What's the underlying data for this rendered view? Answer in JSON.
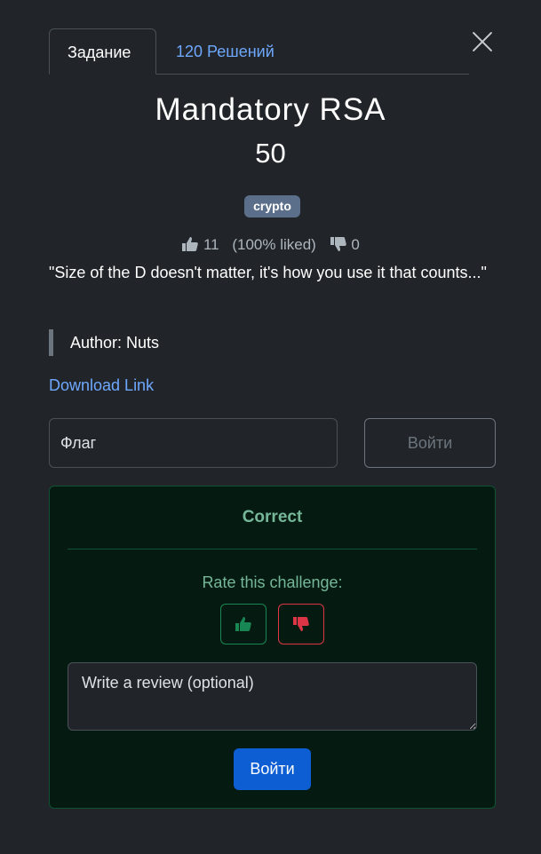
{
  "tabs": [
    {
      "label": "Задание",
      "active": true
    },
    {
      "label": "120 Решений",
      "active": false
    }
  ],
  "challenge": {
    "title": "Mandatory RSA",
    "points": "50",
    "tag": "crypto",
    "likes": "11",
    "liked_percent": "(100% liked)",
    "dislikes": "0",
    "description": "\"Size of the D doesn't matter, it's how you use it that counts...\"",
    "author": "Author: Nuts",
    "download_link": "Download Link"
  },
  "flag_form": {
    "placeholder": "Флаг",
    "submit_label": "Войти"
  },
  "result": {
    "status": "Correct",
    "rate_label": "Rate this challenge:",
    "review_placeholder": "Write a review (optional)",
    "submit_label": "Войти"
  },
  "icons": {
    "close": "close-icon",
    "like": "thumbs-up-icon",
    "dislike": "thumbs-down-icon"
  },
  "colors": {
    "background": "#212529",
    "link": "#6ea8fe",
    "success_text": "#75b798",
    "success_bg": "#051b11",
    "upvote": "#198754",
    "downvote": "#dc3545",
    "primary_button": "#0d5ed3",
    "tag_bg": "#5c6f8a"
  }
}
